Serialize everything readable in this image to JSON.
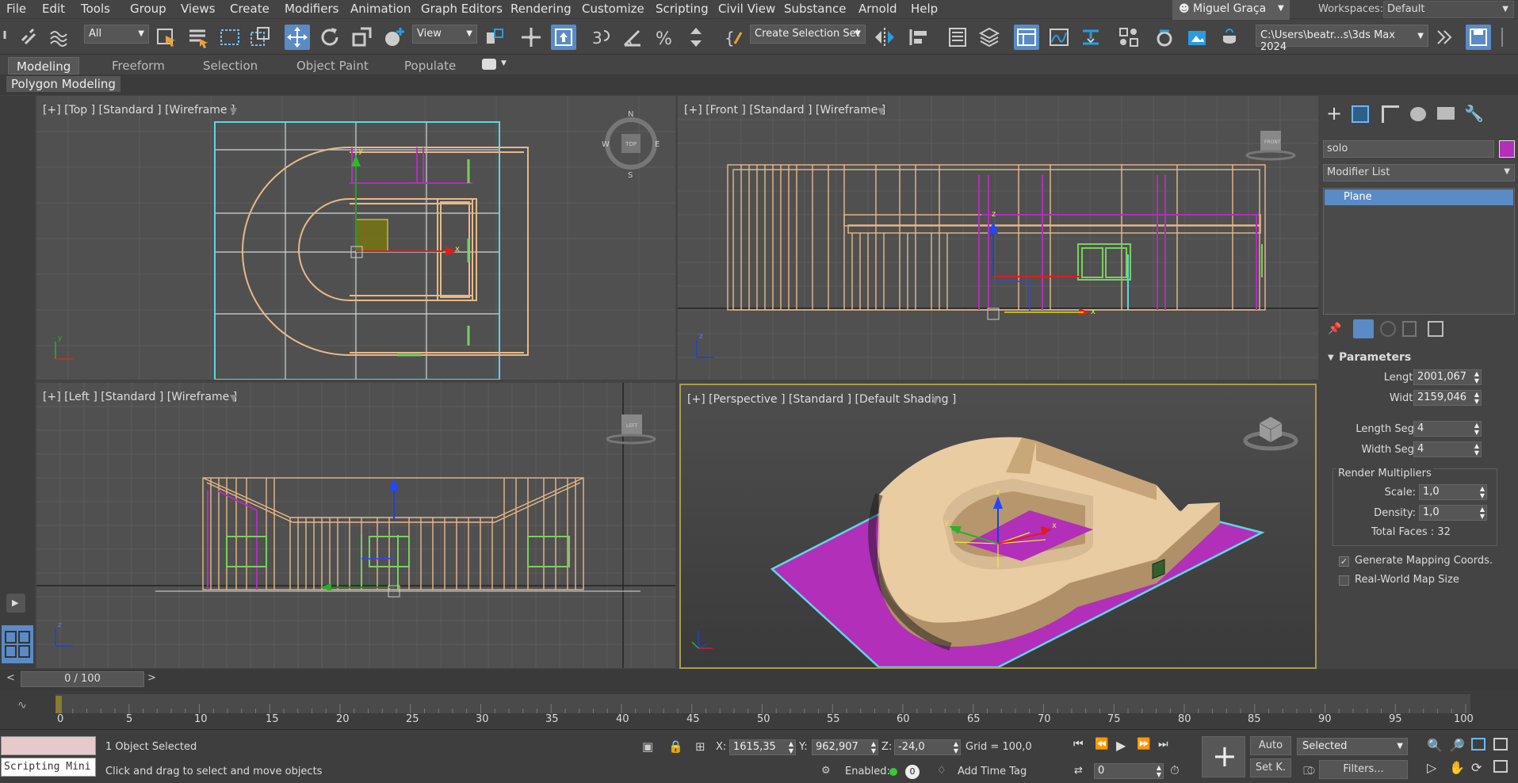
{
  "menu": [
    "File",
    "Edit",
    "Tools",
    "Group",
    "Views",
    "Create",
    "Modifiers",
    "Animation",
    "Graph Editors",
    "Rendering",
    "Customize",
    "Scripting",
    "Civil View",
    "Substance",
    "Arnold",
    "Help"
  ],
  "user": "Miguel Graça",
  "workspaces_label": "Workspaces:",
  "workspace": "Default",
  "toolbar": {
    "filter_value": "All",
    "ref_coord": "View",
    "selection_set": "Create Selection Set",
    "project_path": "C:\\Users\\beatr...s\\3ds Max 2024"
  },
  "ribbon_tabs": [
    "Modeling",
    "Freeform",
    "Selection",
    "Object Paint",
    "Populate"
  ],
  "ribbon_sub": "Polygon Modeling",
  "viewports": {
    "top": "[+] [Top ] [Standard ] [Wireframe ]",
    "front": "[+] [Front ] [Standard ] [Wireframe ]",
    "left": "[+] [Left ] [Standard ] [Wireframe ]",
    "perspective": "[+] [Perspective ] [Standard ] [Default Shading ]"
  },
  "cmd": {
    "object_name": "solo",
    "object_color": "#b12fb9",
    "modifier_list": "Modifier List",
    "stack_item": "Plane",
    "rollout": "Parameters",
    "length_label": "Length:",
    "length": "2001,067",
    "width_label": "Width:",
    "width": "2159,046",
    "lsegs_label": "Length Segs:",
    "lsegs": "4",
    "wsegs_label": "Width Segs:",
    "wsegs": "4",
    "render_mult": "Render Multipliers",
    "scale_label": "Scale:",
    "scale": "1,0",
    "density_label": "Density:",
    "density": "1,0",
    "total_faces": "Total Faces : 32",
    "gen_mapping": "Generate Mapping Coords.",
    "real_world": "Real-World Map Size"
  },
  "timeline": {
    "frame": "0 / 100",
    "ticks": [
      "0",
      "5",
      "10",
      "15",
      "20",
      "25",
      "30",
      "35",
      "40",
      "45",
      "50",
      "55",
      "60",
      "65",
      "70",
      "75",
      "80",
      "85",
      "90",
      "95",
      "100"
    ]
  },
  "status": {
    "script_label": "Scripting Mini",
    "selected": "1 Object Selected",
    "prompt": "Click and drag to select and move objects",
    "x_label": "X:",
    "x": "1615,35",
    "y_label": "Y:",
    "y": "962,907",
    "z_label": "Z:",
    "z": "-24,0",
    "grid": "Grid = 100,0",
    "enabled": "Enabled:",
    "add_time_tag": "Add Time Tag",
    "auto": "Auto",
    "set_key": "Set K.",
    "selected_dd": "Selected",
    "filters": "Filters...",
    "frame_field": "0"
  },
  "colors": {
    "accent": "#5a8bc5",
    "wire": "#e8b98a",
    "selection": "#5fd6e6",
    "magenta": "#b12fb9",
    "active_border": "#ab9b4c"
  }
}
